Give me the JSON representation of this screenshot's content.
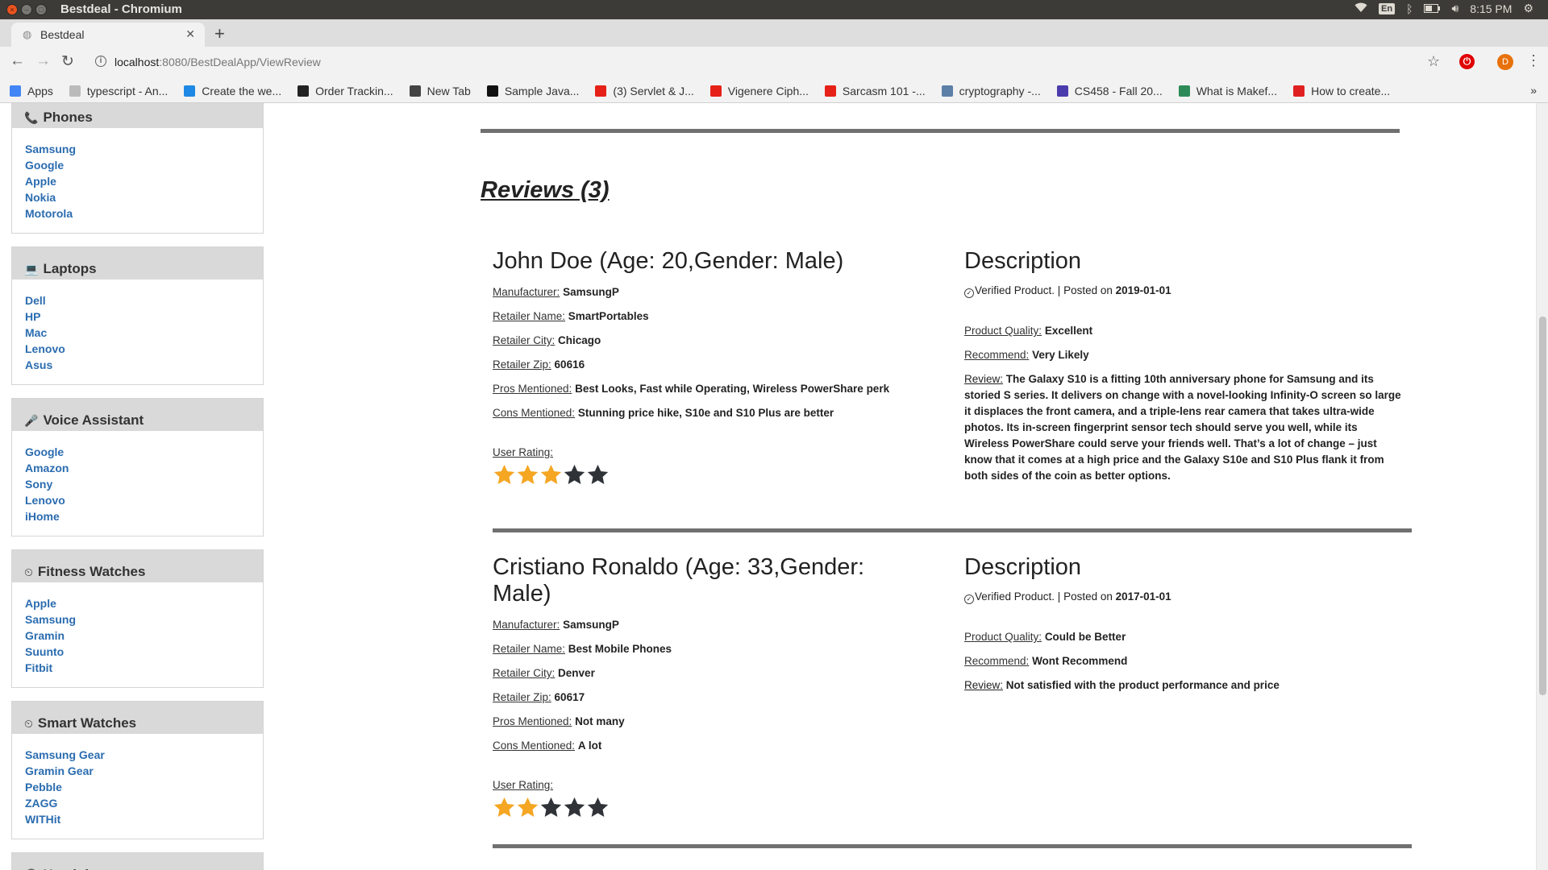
{
  "os": {
    "window_title": "Bestdeal - Chromium",
    "lang": "En",
    "clock": "8:15 PM"
  },
  "browser": {
    "tab_title": "Bestdeal",
    "url_host": "localhost",
    "url_rest": ":8080/BestDealApp/ViewReview",
    "profile_initial": "D",
    "bookmarks": [
      {
        "label": "Apps",
        "icon": "apps-grid-icon",
        "color": "#4285f4"
      },
      {
        "label": "typescript - An...",
        "icon": "page-icon",
        "color": "#bbbbbb"
      },
      {
        "label": "Create the we...",
        "icon": "vscode-icon",
        "color": "#1e88e5"
      },
      {
        "label": "Order Trackin...",
        "icon": "e-icon",
        "color": "#222222"
      },
      {
        "label": "New Tab",
        "icon": "globe-icon",
        "color": "#444444"
      },
      {
        "label": "Sample Java...",
        "icon": "m-icon",
        "color": "#111111"
      },
      {
        "label": "(3) Servlet & J...",
        "icon": "youtube-icon",
        "color": "#e62117"
      },
      {
        "label": "Vigenere Ciph...",
        "icon": "youtube-icon",
        "color": "#e62117"
      },
      {
        "label": "Sarcasm 101 -...",
        "icon": "youtube-icon",
        "color": "#e62117"
      },
      {
        "label": "cryptography -...",
        "icon": "shield-icon",
        "color": "#5b7fa6"
      },
      {
        "label": "CS458 - Fall 20...",
        "icon": "calendar-icon",
        "color": "#4b3cad"
      },
      {
        "label": "What is Makef...",
        "icon": "leaf-icon",
        "color": "#2e8b57"
      },
      {
        "label": "How to create...",
        "icon": "v-icon",
        "color": "#e02020"
      }
    ]
  },
  "sidebar": {
    "categories": [
      {
        "title": "Phones",
        "icon": "phone-icon",
        "glyph": "📞",
        "items": [
          "Samsung",
          "Google",
          "Apple",
          "Nokia",
          "Motorola"
        ]
      },
      {
        "title": "Laptops",
        "icon": "laptop-icon",
        "glyph": "💻",
        "items": [
          "Dell",
          "HP",
          "Mac",
          "Lenovo",
          "Asus"
        ]
      },
      {
        "title": "Voice Assistant",
        "icon": "microphone-icon",
        "glyph": "🎤",
        "items": [
          "Google",
          "Amazon",
          "Sony",
          "Lenovo",
          "iHome"
        ]
      },
      {
        "title": "Fitness Watches",
        "icon": "clock-icon",
        "glyph": "⏲",
        "items": [
          "Apple",
          "Samsung",
          "Gramin",
          "Suunto",
          "Fitbit"
        ]
      },
      {
        "title": "Smart Watches",
        "icon": "clock-icon",
        "glyph": "⏲",
        "items": [
          "Samsung Gear",
          "Gramin Gear",
          "Pebble",
          "ZAGG",
          "WITHit"
        ]
      },
      {
        "title": "Headphones",
        "icon": "headphones-icon",
        "glyph": "🎧",
        "items": []
      }
    ]
  },
  "reviews": {
    "heading": "Reviews (3)",
    "labels": {
      "manufacturer": "Manufacturer:",
      "retailer_name": "Retailer Name:",
      "retailer_city": "Retailer City:",
      "retailer_zip": "Retailer Zip:",
      "pros": "Pros Mentioned:",
      "cons": "Cons Mentioned:",
      "user_rating": "User Rating:",
      "description": "Description",
      "verified": "Verified Product. | Posted on ",
      "quality": "Product Quality:",
      "recommend": "Recommend:",
      "review": "Review:"
    },
    "items": [
      {
        "reviewer": "John Doe (Age: 20,Gender: Male)",
        "manufacturer": "SamsungP",
        "retailer_name": "SmartPortables",
        "retailer_city": "Chicago",
        "retailer_zip": "60616",
        "pros": "Best Looks, Fast while Operating, Wireless PowerShare perk",
        "cons": "Stunning price hike, S10e and S10 Plus are better",
        "rating": 3,
        "rating_max": 5,
        "posted_on": "2019-01-01",
        "quality": "Excellent",
        "recommend": "Very Likely",
        "review": "The Galaxy S10 is a fitting 10th anniversary phone for Samsung and its storied S series. It delivers on change with a novel-looking Infinity-O screen so large it displaces the front camera, and a triple-lens rear camera that takes ultra-wide photos. Its in-screen fingerprint sensor tech should serve you well, while its Wireless PowerShare could serve your friends well. That’s a lot of change – just know that it comes at a high price and the Galaxy S10e and S10 Plus flank it from both sides of the coin as better options."
      },
      {
        "reviewer": "Cristiano Ronaldo (Age: 33,Gender: Male)",
        "manufacturer": "SamsungP",
        "retailer_name": "Best Mobile Phones",
        "retailer_city": "Denver",
        "retailer_zip": "60617",
        "pros": "Not many",
        "cons": "A lot",
        "rating": 2,
        "rating_max": 5,
        "posted_on": "2017-01-01",
        "quality": "Could be Better",
        "recommend": "Wont Recommend",
        "review": "Not satisfied with the product performance and price"
      }
    ]
  },
  "colors": {
    "star_filled": "#f5a623",
    "star_empty": "#2f3338",
    "link": "#2b6cb0"
  }
}
